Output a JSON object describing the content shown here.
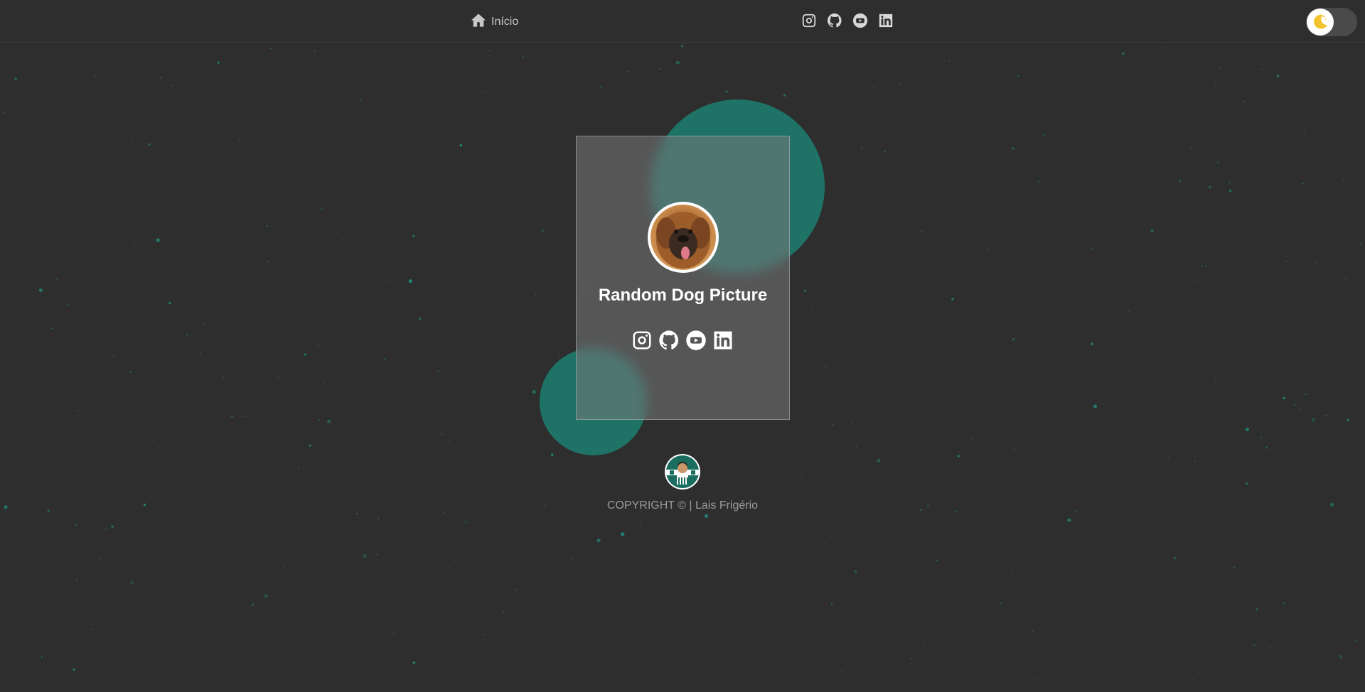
{
  "header": {
    "home_label": "Início",
    "social_icons": [
      "instagram-icon",
      "github-icon",
      "youtube-icon",
      "linkedin-icon"
    ]
  },
  "theme_toggle": {
    "icon": "moon-icon",
    "mode": "dark"
  },
  "card": {
    "avatar_icon": "dog-photo",
    "title": "Random Dog Picture",
    "social_icons": [
      "instagram-icon",
      "github-icon",
      "youtube-icon",
      "linkedin-icon"
    ]
  },
  "footer": {
    "logo_icon": "author-avatar-logo",
    "copyright": "COPYRIGHT © | Lais Frigério"
  },
  "colors": {
    "background": "#2e2e2e",
    "accent": "#1e7366",
    "particle": "#1f8a78",
    "text_muted": "#9a9a9a"
  }
}
